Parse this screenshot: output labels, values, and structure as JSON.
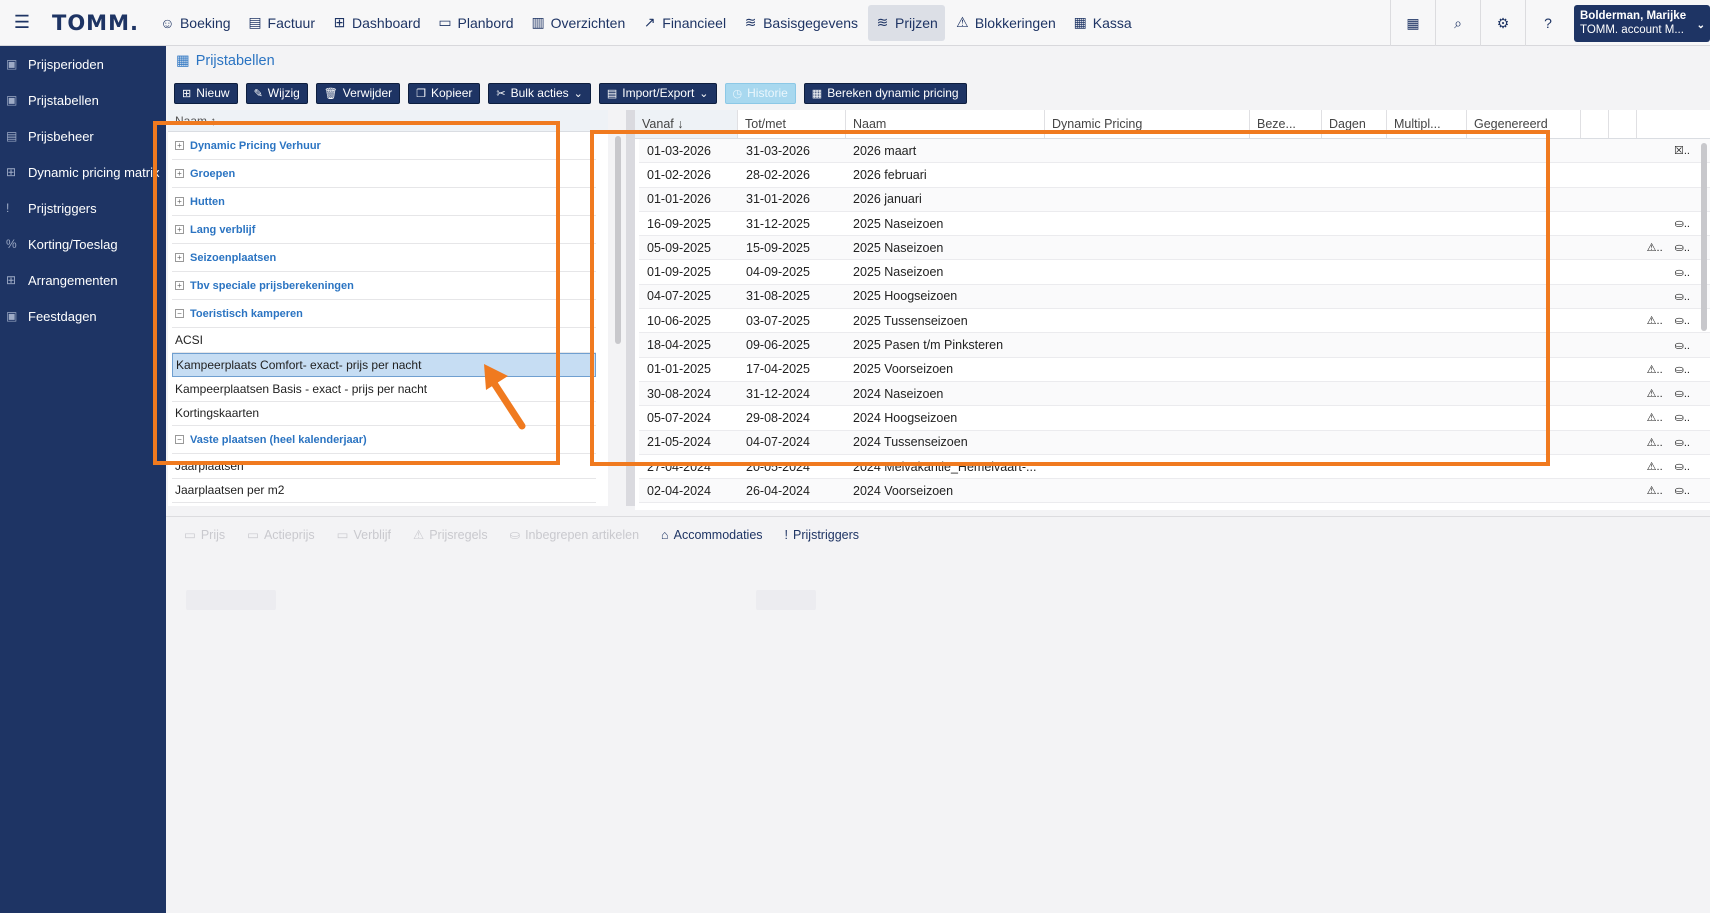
{
  "topbar": {
    "logo": "TOMM.",
    "nav": [
      {
        "label": "Boeking",
        "icon": "☺"
      },
      {
        "label": "Factuur",
        "icon": "▤"
      },
      {
        "label": "Dashboard",
        "icon": "⊞"
      },
      {
        "label": "Planbord",
        "icon": "▭"
      },
      {
        "label": "Overzichten",
        "icon": "▥"
      },
      {
        "label": "Financieel",
        "icon": "↗"
      },
      {
        "label": "Basisgegevens",
        "icon": "≋"
      },
      {
        "label": "Prijzen",
        "icon": "≋"
      },
      {
        "label": "Blokkeringen",
        "icon": "⚠"
      },
      {
        "label": "Kassa",
        "icon": "▦"
      }
    ],
    "active": "Prijzen",
    "user_name": "Bolderman, Marijke",
    "user_account": "TOMM. account M..."
  },
  "sidebar": {
    "items": [
      {
        "label": "Prijsperioden",
        "icon": "▣"
      },
      {
        "label": "Prijstabellen",
        "icon": "▣"
      },
      {
        "label": "Prijsbeheer",
        "icon": "▤"
      },
      {
        "label": "Dynamic pricing matrix",
        "icon": "⊞"
      },
      {
        "label": "Prijstriggers",
        "icon": "!"
      },
      {
        "label": "Korting/Toeslag",
        "icon": "%"
      },
      {
        "label": "Arrangementen",
        "icon": "⊞"
      },
      {
        "label": "Feestdagen",
        "icon": "▣"
      }
    ]
  },
  "page": {
    "title": "Prijstabellen"
  },
  "toolbar": {
    "new": "Nieuw",
    "edit": "Wijzig",
    "delete": "Verwijder",
    "copy": "Kopieer",
    "bulk": "Bulk acties",
    "import": "Import/Export",
    "history": "Historie",
    "dynamic": "Bereken dynamic pricing"
  },
  "left": {
    "header": "Naam ↑",
    "rows": [
      {
        "label": "Dynamic Pricing Verhuur",
        "group": true,
        "exp": "+"
      },
      {
        "label": "Groepen",
        "group": true,
        "exp": "+"
      },
      {
        "label": "Hutten",
        "group": true,
        "exp": "+"
      },
      {
        "label": "Lang verblijf",
        "group": true,
        "exp": "+"
      },
      {
        "label": "Seizoenplaatsen",
        "group": true,
        "exp": "+"
      },
      {
        "label": "Tbv speciale prijsberekeningen",
        "group": true,
        "exp": "+"
      },
      {
        "label": "Toeristisch kamperen",
        "group": true,
        "exp": "−"
      },
      {
        "label": "ACSI",
        "group": false
      },
      {
        "label": "Kampeerplaats Comfort- exact- prijs per nacht",
        "group": false,
        "selected": true
      },
      {
        "label": "Kampeerplaatsen Basis - exact - prijs per nacht",
        "group": false
      },
      {
        "label": "Kortingskaarten",
        "group": false
      },
      {
        "label": "Vaste plaatsen (heel kalenderjaar)",
        "group": true,
        "exp": "−"
      },
      {
        "label": "Jaarplaatsen",
        "group": false
      },
      {
        "label": "Jaarplaatsen per m2",
        "group": false
      }
    ]
  },
  "right": {
    "headers": [
      {
        "label": "Vanaf ↓",
        "w": 103,
        "act": true
      },
      {
        "label": "Tot/met",
        "w": 108
      },
      {
        "label": "Naam",
        "w": 199
      },
      {
        "label": "Dynamic Pricing",
        "w": 205
      },
      {
        "label": "Beze...",
        "w": 72
      },
      {
        "label": "Dagen",
        "w": 65
      },
      {
        "label": "Multipl...",
        "w": 80
      },
      {
        "label": "Gegenereerd",
        "w": 114
      },
      {
        "label": "",
        "w": 28
      },
      {
        "label": "",
        "w": 28
      }
    ],
    "rows": [
      {
        "from": "01-03-2026",
        "to": "31-03-2026",
        "name": "2026 maart",
        "a": "",
        "b": "☒.."
      },
      {
        "from": "01-02-2026",
        "to": "28-02-2026",
        "name": "2026 februari",
        "a": "",
        "b": ""
      },
      {
        "from": "01-01-2026",
        "to": "31-01-2026",
        "name": "2026 januari",
        "a": "",
        "b": ""
      },
      {
        "from": "16-09-2025",
        "to": "31-12-2025",
        "name": "2025 Naseizoen",
        "a": "",
        "b": "⛀.."
      },
      {
        "from": "05-09-2025",
        "to": "15-09-2025",
        "name": "2025 Naseizoen",
        "a": "⚠..",
        "b": "⛀.."
      },
      {
        "from": "01-09-2025",
        "to": "04-09-2025",
        "name": "2025 Naseizoen",
        "a": "",
        "b": "⛀.."
      },
      {
        "from": "04-07-2025",
        "to": "31-08-2025",
        "name": "2025 Hoogseizoen",
        "a": "",
        "b": "⛀.."
      },
      {
        "from": "10-06-2025",
        "to": "03-07-2025",
        "name": "2025 Tussenseizoen",
        "a": "⚠..",
        "b": "⛀.."
      },
      {
        "from": "18-04-2025",
        "to": "09-06-2025",
        "name": "2025 Pasen t/m Pinksteren",
        "a": "",
        "b": "⛀.."
      },
      {
        "from": "01-01-2025",
        "to": "17-04-2025",
        "name": "2025 Voorseizoen",
        "a": "⚠..",
        "b": "⛀.."
      },
      {
        "from": "30-08-2024",
        "to": "31-12-2024",
        "name": "2024 Naseizoen",
        "a": "⚠..",
        "b": "⛀.."
      },
      {
        "from": "05-07-2024",
        "to": "29-08-2024",
        "name": "2024 Hoogseizoen",
        "a": "⚠..",
        "b": "⛀.."
      },
      {
        "from": "21-05-2024",
        "to": "04-07-2024",
        "name": "2024 Tussenseizoen",
        "a": "⚠..",
        "b": "⛀.."
      },
      {
        "from": "27-04-2024",
        "to": "20-05-2024",
        "name": "2024 Meivakantie_Hemelvaart-...",
        "a": "⚠..",
        "b": "⛀.."
      },
      {
        "from": "02-04-2024",
        "to": "26-04-2024",
        "name": "2024 Voorseizoen",
        "a": "⚠..",
        "b": "⛀.."
      }
    ]
  },
  "tabs": [
    {
      "label": "Prijs",
      "icon": "▭",
      "enabled": false
    },
    {
      "label": "Actieprijs",
      "icon": "▭",
      "enabled": false
    },
    {
      "label": "Verblijf",
      "icon": "▭",
      "enabled": false
    },
    {
      "label": "Prijsregels",
      "icon": "⚠",
      "enabled": false
    },
    {
      "label": "Inbegrepen artikelen",
      "icon": "⛀",
      "enabled": false
    },
    {
      "label": "Accommodaties",
      "icon": "⌂",
      "enabled": true
    },
    {
      "label": "Prijstriggers",
      "icon": "!",
      "enabled": true
    }
  ],
  "colors": {
    "navy": "#1e3464",
    "highlight": "#f07a1f",
    "link": "#2b74c2"
  }
}
